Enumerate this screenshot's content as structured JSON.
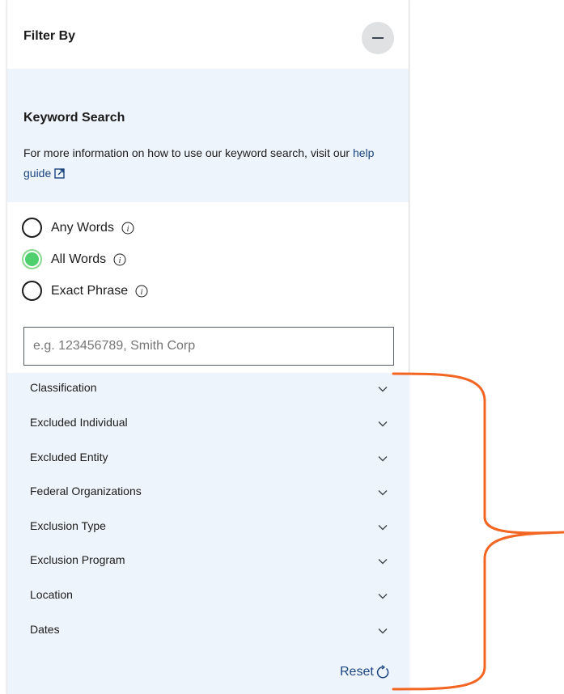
{
  "panel": {
    "title": "Filter By",
    "collapse_icon": "minus-icon"
  },
  "keyword": {
    "title": "Keyword Search",
    "description": "For more information on how to use our keyword search, visit our",
    "help_link": "help guide",
    "help_icon": "external-link-icon"
  },
  "radios": [
    {
      "label": "Any Words",
      "checked": false
    },
    {
      "label": "All Words",
      "checked": true
    },
    {
      "label": "Exact Phrase",
      "checked": false
    }
  ],
  "search": {
    "placeholder": "e.g. 123456789, Smith Corp",
    "value": ""
  },
  "filters": [
    {
      "label": "Classification"
    },
    {
      "label": "Excluded Individual"
    },
    {
      "label": "Excluded Entity"
    },
    {
      "label": "Federal Organizations"
    },
    {
      "label": "Exclusion Type"
    },
    {
      "label": "Exclusion Program"
    },
    {
      "label": "Location"
    },
    {
      "label": "Dates"
    }
  ],
  "reset": {
    "label": "Reset",
    "icon": "refresh-icon"
  },
  "colors": {
    "panel_bg": "#eef4fb",
    "link": "#1a4480",
    "radio_checked": "#4fd06c",
    "annotation": "#f26522"
  }
}
